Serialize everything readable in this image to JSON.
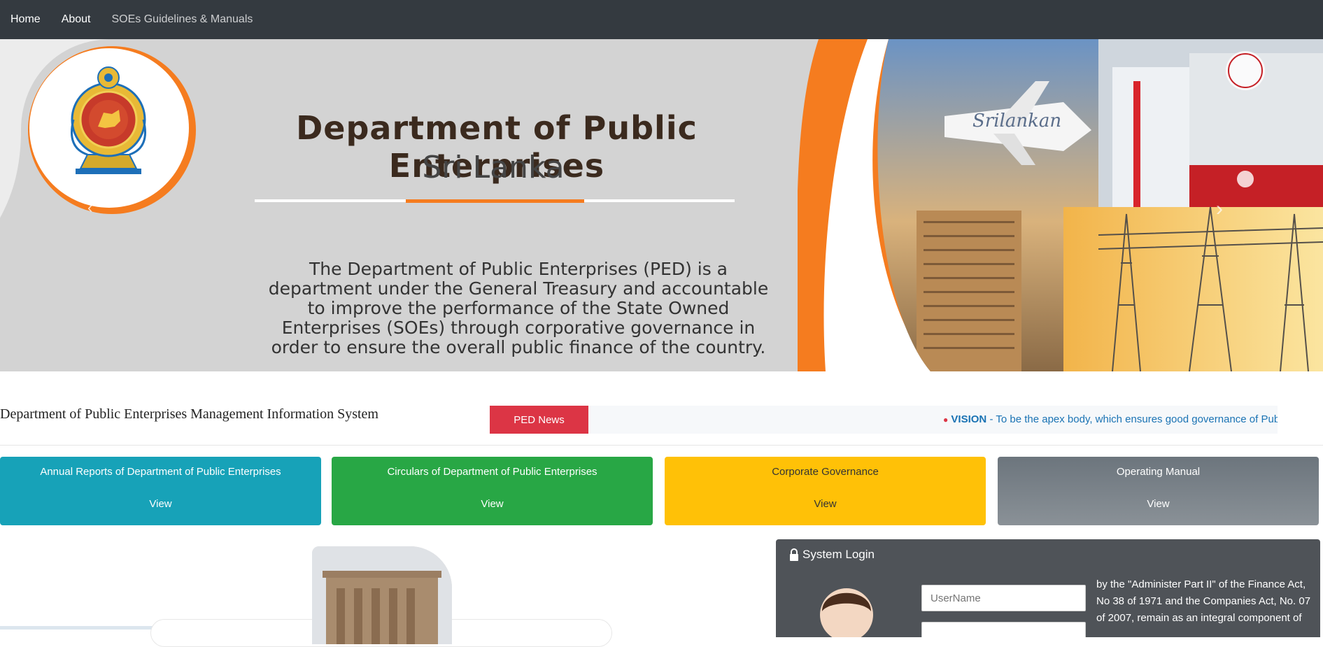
{
  "nav": {
    "home": "Home",
    "about": "About",
    "guidelines": "SOEs Guidelines & Manuals"
  },
  "banner": {
    "title": "Department of Public Enterprises",
    "subtitle": "Sri Lanka",
    "description": "The Department of Public Enterprises (PED) is a department under the General Treasury and accountable to improve the performance of the State Owned Enterprises (SOEs) through corporative governance in order to ensure the overall public finance of the country.",
    "accent_color": "#f57c1f"
  },
  "mis_title": "Department of Public Enterprises Management Information System",
  "news": {
    "label": "PED News",
    "heading": "VISION",
    "text": " - To be the apex body, which ensures good governance of Publi"
  },
  "cards": [
    {
      "title": "Annual Reports of Department of Public Enterprises",
      "link": "View"
    },
    {
      "title": "Circulars of Department of Public Enterprises",
      "link": "View"
    },
    {
      "title": "Corporate Governance",
      "link": "View"
    },
    {
      "title": "Operating Manual",
      "link": "View"
    }
  ],
  "login": {
    "title": "System Login",
    "username_placeholder": "UserName",
    "text": "by the \"Administer Part II\" of the Finance Act, No 38 of 1971 and the Companies Act, No. 07 of 2007, remain as an integral component of"
  },
  "icons": [
    "lock-icon",
    "user-avatar-icon",
    "chevron-right-icon",
    "chevron-left-icon",
    "emblem-logo"
  ]
}
